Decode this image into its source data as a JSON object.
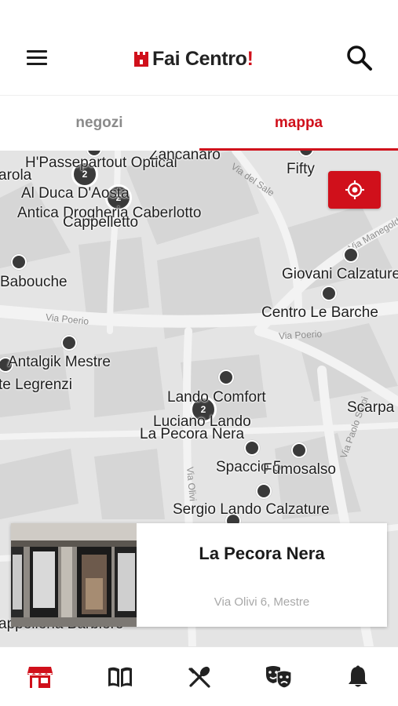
{
  "header": {
    "logo_main": "Fai Centro",
    "logo_bang": "!",
    "menu_icon": "hamburger-menu-icon",
    "search_icon": "search-icon"
  },
  "tabs": [
    {
      "label": "negozi",
      "active": false
    },
    {
      "label": "mappa",
      "active": true
    }
  ],
  "colors": {
    "accent": "#d0101b",
    "marker": "#3a3a3a",
    "tab_inactive": "#8a8a8a"
  },
  "map": {
    "locate_icon": "locate-crosshair-icon",
    "street_names": [
      "Via Poerio",
      "Via Poerio",
      "Via Olivi",
      "Via Paolo Sarpi",
      "Via del Sale",
      "Via Manegold"
    ],
    "clusters": [
      "2",
      "2",
      "2"
    ],
    "shops": [
      "H'Passepartout Optical",
      "arola",
      "Zancanaro",
      "Fifty",
      "Al Duca D'Aosta",
      "Antica Drogheria Caberlotto",
      "Cappelletto",
      "Giovani Calzature",
      "Babouche",
      "Centro Le Barche",
      "Antalgik Mestre",
      "te Legrenzi",
      "Lando Comfort",
      "Scarpa",
      "Luciano Lando",
      "La Pecora Nera",
      "Spaccio 5",
      "Fumosalso",
      "Sergio Lando Calzature",
      "appelleria Barbiero"
    ]
  },
  "selected_shop": {
    "name": "La Pecora Nera",
    "address": "Via Olivi 6, Mestre"
  },
  "bottom_nav": [
    {
      "name": "shops-icon",
      "active": true
    },
    {
      "name": "book-icon",
      "active": false
    },
    {
      "name": "restaurant-icon",
      "active": false
    },
    {
      "name": "theater-masks-icon",
      "active": false
    },
    {
      "name": "bell-icon",
      "active": false
    }
  ]
}
